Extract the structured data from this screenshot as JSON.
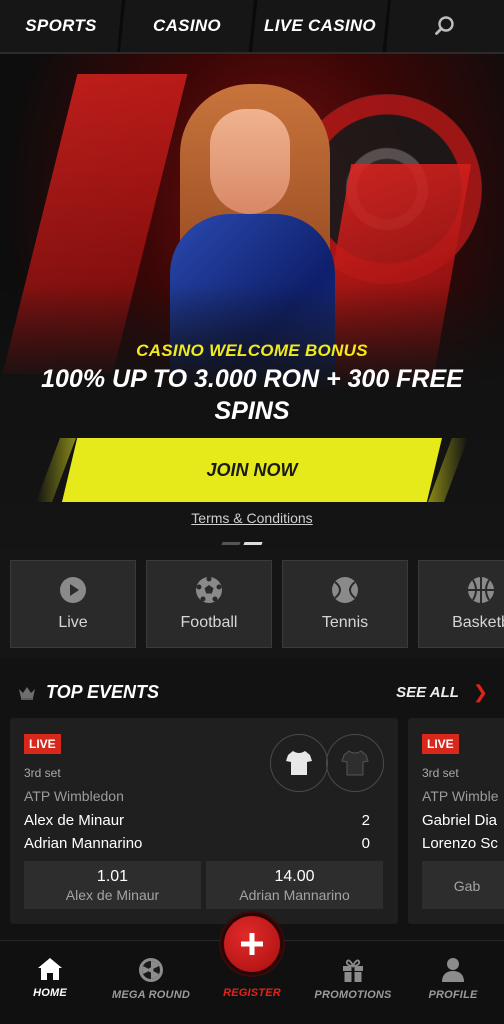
{
  "topnav": {
    "tabs": [
      "SPORTS",
      "CASINO",
      "LIVE CASINO"
    ],
    "search_icon": "search-icon"
  },
  "hero": {
    "subtitle": "CASINO WELCOME BONUS",
    "title": "100% UP TO 3.000 RON + 300 FREE SPINS",
    "cta": "JOIN NOW",
    "terms": "Terms & Conditions",
    "carousel": {
      "count": 2,
      "active_index": 1
    }
  },
  "categories": [
    {
      "label": "Live",
      "icon": "play-icon"
    },
    {
      "label": "Football",
      "icon": "football-icon"
    },
    {
      "label": "Tennis",
      "icon": "tennis-icon"
    },
    {
      "label": "Basketb",
      "icon": "basketball-icon"
    }
  ],
  "events": {
    "title": "TOP EVENTS",
    "see_all": "SEE ALL",
    "cards": [
      {
        "badge": "LIVE",
        "status": "3rd set",
        "tournament": "ATP Wimbledon",
        "player1": "Alex de Minaur",
        "player2": "Adrian Mannarino",
        "score1": "2",
        "score2": "0",
        "odds": [
          {
            "value": "1.01",
            "name": "Alex de Minaur"
          },
          {
            "value": "14.00",
            "name": "Adrian Mannarino"
          }
        ]
      },
      {
        "badge": "LIVE",
        "status": "3rd set",
        "tournament": "ATP Wimble",
        "player1": "Gabriel Dia",
        "player2": "Lorenzo Sc",
        "odd_name": "Gab"
      }
    ]
  },
  "bottomnav": {
    "items": [
      "HOME",
      "MEGA ROUND",
      "REGISTER",
      "PROMOTIONS",
      "PROFILE"
    ],
    "active": "HOME",
    "accent": "#e2231a"
  }
}
